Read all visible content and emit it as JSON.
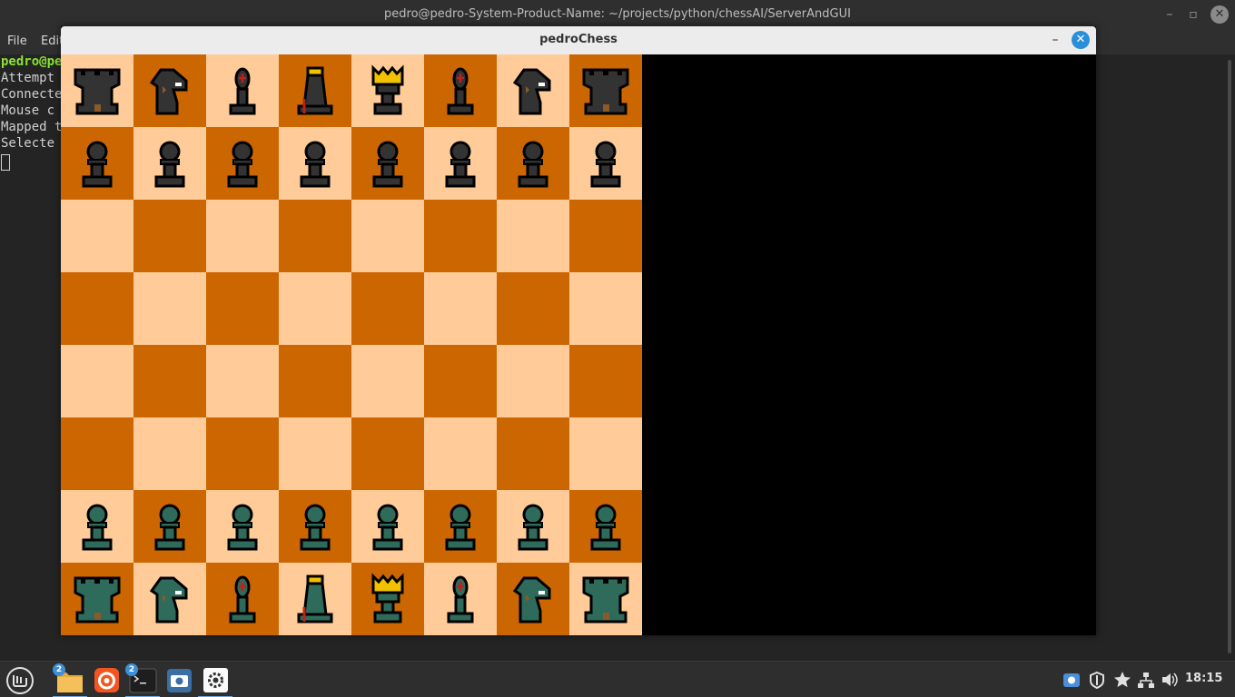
{
  "terminal": {
    "title": "pedro@pedro-System-Product-Name: ~/projects/python/chessAI/ServerAndGUI",
    "menu": {
      "file": "File",
      "edit": "Edit"
    },
    "lines": [
      "pedro@pe",
      "Attempt",
      "Connecte",
      "Mouse c",
      "Mapped t",
      "Selecte"
    ]
  },
  "chess_window": {
    "title": "pedroChess",
    "colors": {
      "light_square": "#ffcc99",
      "dark_square": "#cc6600",
      "black_pieces": "#333333",
      "white_pieces": "#2e6b5a",
      "crown_accent": "#f2c200",
      "panel": "#000000"
    },
    "board": [
      [
        "bR",
        "bN",
        "bB",
        "bQ",
        "bK",
        "bB",
        "bN",
        "bR"
      ],
      [
        "bP",
        "bP",
        "bP",
        "bP",
        "bP",
        "bP",
        "bP",
        "bP"
      ],
      [
        "",
        "",
        "",
        "",
        "",
        "",
        "",
        ""
      ],
      [
        "",
        "",
        "",
        "",
        "",
        "",
        "",
        ""
      ],
      [
        "",
        "",
        "",
        "",
        "",
        "",
        "",
        ""
      ],
      [
        "",
        "",
        "",
        "",
        "",
        "",
        "",
        ""
      ],
      [
        "wP",
        "wP",
        "wP",
        "wP",
        "wP",
        "wP",
        "wP",
        "wP"
      ],
      [
        "wR",
        "wN",
        "wB",
        "wQ",
        "wK",
        "wB",
        "wN",
        "wR"
      ]
    ]
  },
  "taskbar": {
    "apps": [
      {
        "name": "menu-icon"
      },
      {
        "name": "files-icon",
        "badge": "2"
      },
      {
        "name": "firefox-icon"
      },
      {
        "name": "terminal-icon",
        "badge": "2"
      },
      {
        "name": "screenshot-icon"
      },
      {
        "name": "settings-icon"
      }
    ],
    "clock": "18:15"
  }
}
